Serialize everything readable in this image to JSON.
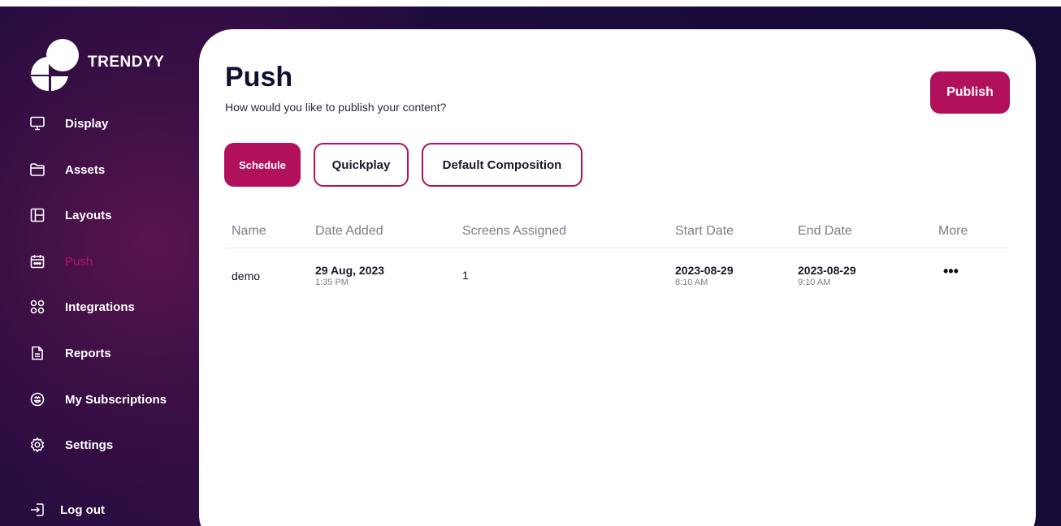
{
  "brand": {
    "name": "TRENDYY"
  },
  "sidebar": {
    "items": [
      {
        "label": "Display",
        "icon": "monitor-icon"
      },
      {
        "label": "Assets",
        "icon": "folder-icon"
      },
      {
        "label": "Layouts",
        "icon": "layout-icon"
      },
      {
        "label": "Push",
        "icon": "calendar-icon",
        "active": true
      },
      {
        "label": "Integrations",
        "icon": "grid-icon"
      },
      {
        "label": "Reports",
        "icon": "report-icon"
      },
      {
        "label": "My Subscriptions",
        "icon": "subscription-icon"
      },
      {
        "label": "Settings",
        "icon": "gear-icon"
      }
    ],
    "logout": {
      "label": "Log out",
      "icon": "logout-icon"
    }
  },
  "main": {
    "title": "Push",
    "subtitle": "How would you like to publish your content?",
    "publish_label": "Publish",
    "tabs": [
      {
        "label": "Schedule",
        "selected": true
      },
      {
        "label": "Quickplay",
        "selected": false
      },
      {
        "label": "Default Composition",
        "selected": false
      }
    ],
    "table": {
      "headers": [
        "Name",
        "Date Added",
        "Screens Assigned",
        "Start Date",
        "End Date",
        "More"
      ],
      "rows": [
        {
          "name": "demo",
          "date_added": "29 Aug, 2023",
          "time_added": "1:35 PM",
          "screens": "1",
          "start_date": "2023-08-29",
          "start_time": "8:10 AM",
          "end_date": "2023-08-29",
          "end_time": "9:10 AM",
          "more": "•••"
        }
      ]
    }
  },
  "colors": {
    "accent": "#b1105c",
    "sidebar_bg": "#1a0b3a",
    "text_dark": "#0f0f30"
  }
}
